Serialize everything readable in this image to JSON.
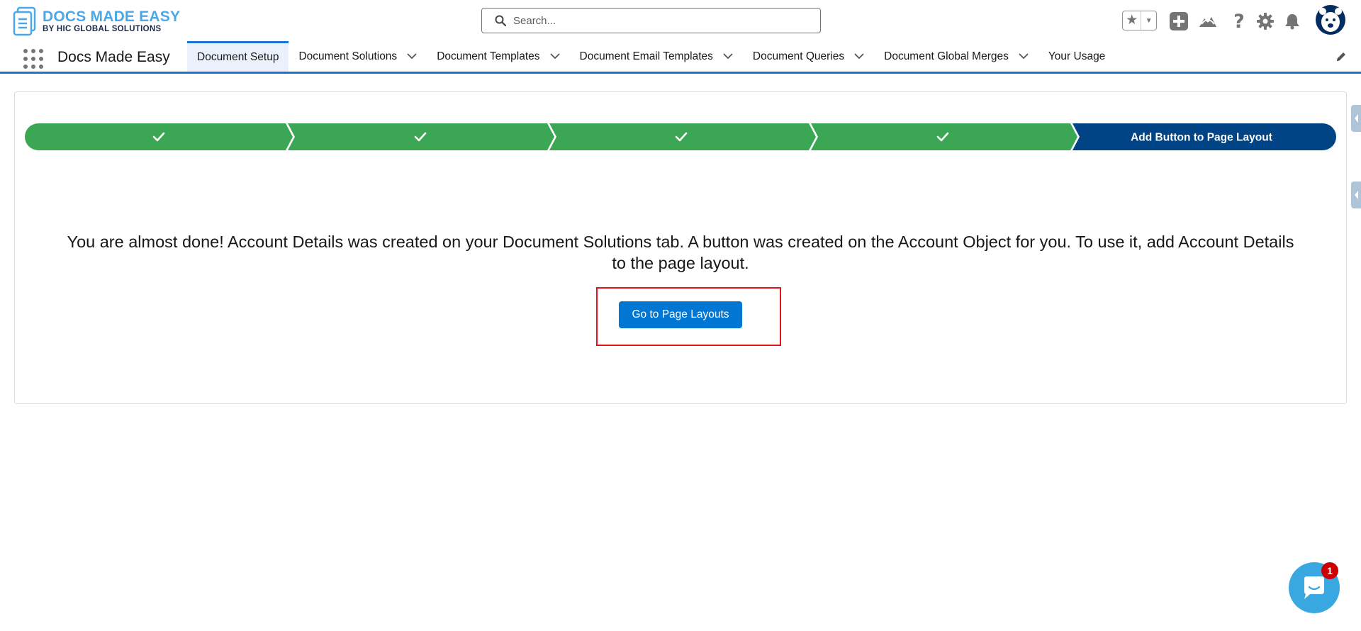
{
  "brand": {
    "title": "DOCS MADE EASY",
    "subtitle": "BY HIC GLOBAL SOLUTIONS"
  },
  "search": {
    "placeholder": "Search..."
  },
  "app_name": "Docs Made Easy",
  "tabs": [
    {
      "label": "Document Setup",
      "active": true,
      "has_menu": false
    },
    {
      "label": "Document Solutions",
      "active": false,
      "has_menu": true
    },
    {
      "label": "Document Templates",
      "active": false,
      "has_menu": true
    },
    {
      "label": "Document Email Templates",
      "active": false,
      "has_menu": true
    },
    {
      "label": "Document Queries",
      "active": false,
      "has_menu": true
    },
    {
      "label": "Document Global Merges",
      "active": false,
      "has_menu": true
    },
    {
      "label": "Your Usage",
      "active": false,
      "has_menu": false
    }
  ],
  "header_icons": [
    "star-icon",
    "add-icon",
    "trailhead-icon",
    "help-icon",
    "setup-gear-icon",
    "notification-bell-icon",
    "user-avatar"
  ],
  "path": {
    "steps": [
      {
        "status": "complete",
        "label": ""
      },
      {
        "status": "complete",
        "label": ""
      },
      {
        "status": "complete",
        "label": ""
      },
      {
        "status": "complete",
        "label": ""
      },
      {
        "status": "current",
        "label": "Add Button to Page Layout"
      }
    ],
    "complete_color": "#3ba755",
    "current_color": "#014486"
  },
  "message": {
    "line1": "You are almost done! Account Details was created on your Document Solutions tab. A button was created on the Account Object for you. To use it, add Account Details",
    "line2": "to the page layout."
  },
  "action_button": {
    "label": "Go to Page Layouts"
  },
  "chat": {
    "badge_count": "1"
  },
  "colors": {
    "brand_blue": "#0176d3",
    "highlight_red": "#e3121b"
  }
}
